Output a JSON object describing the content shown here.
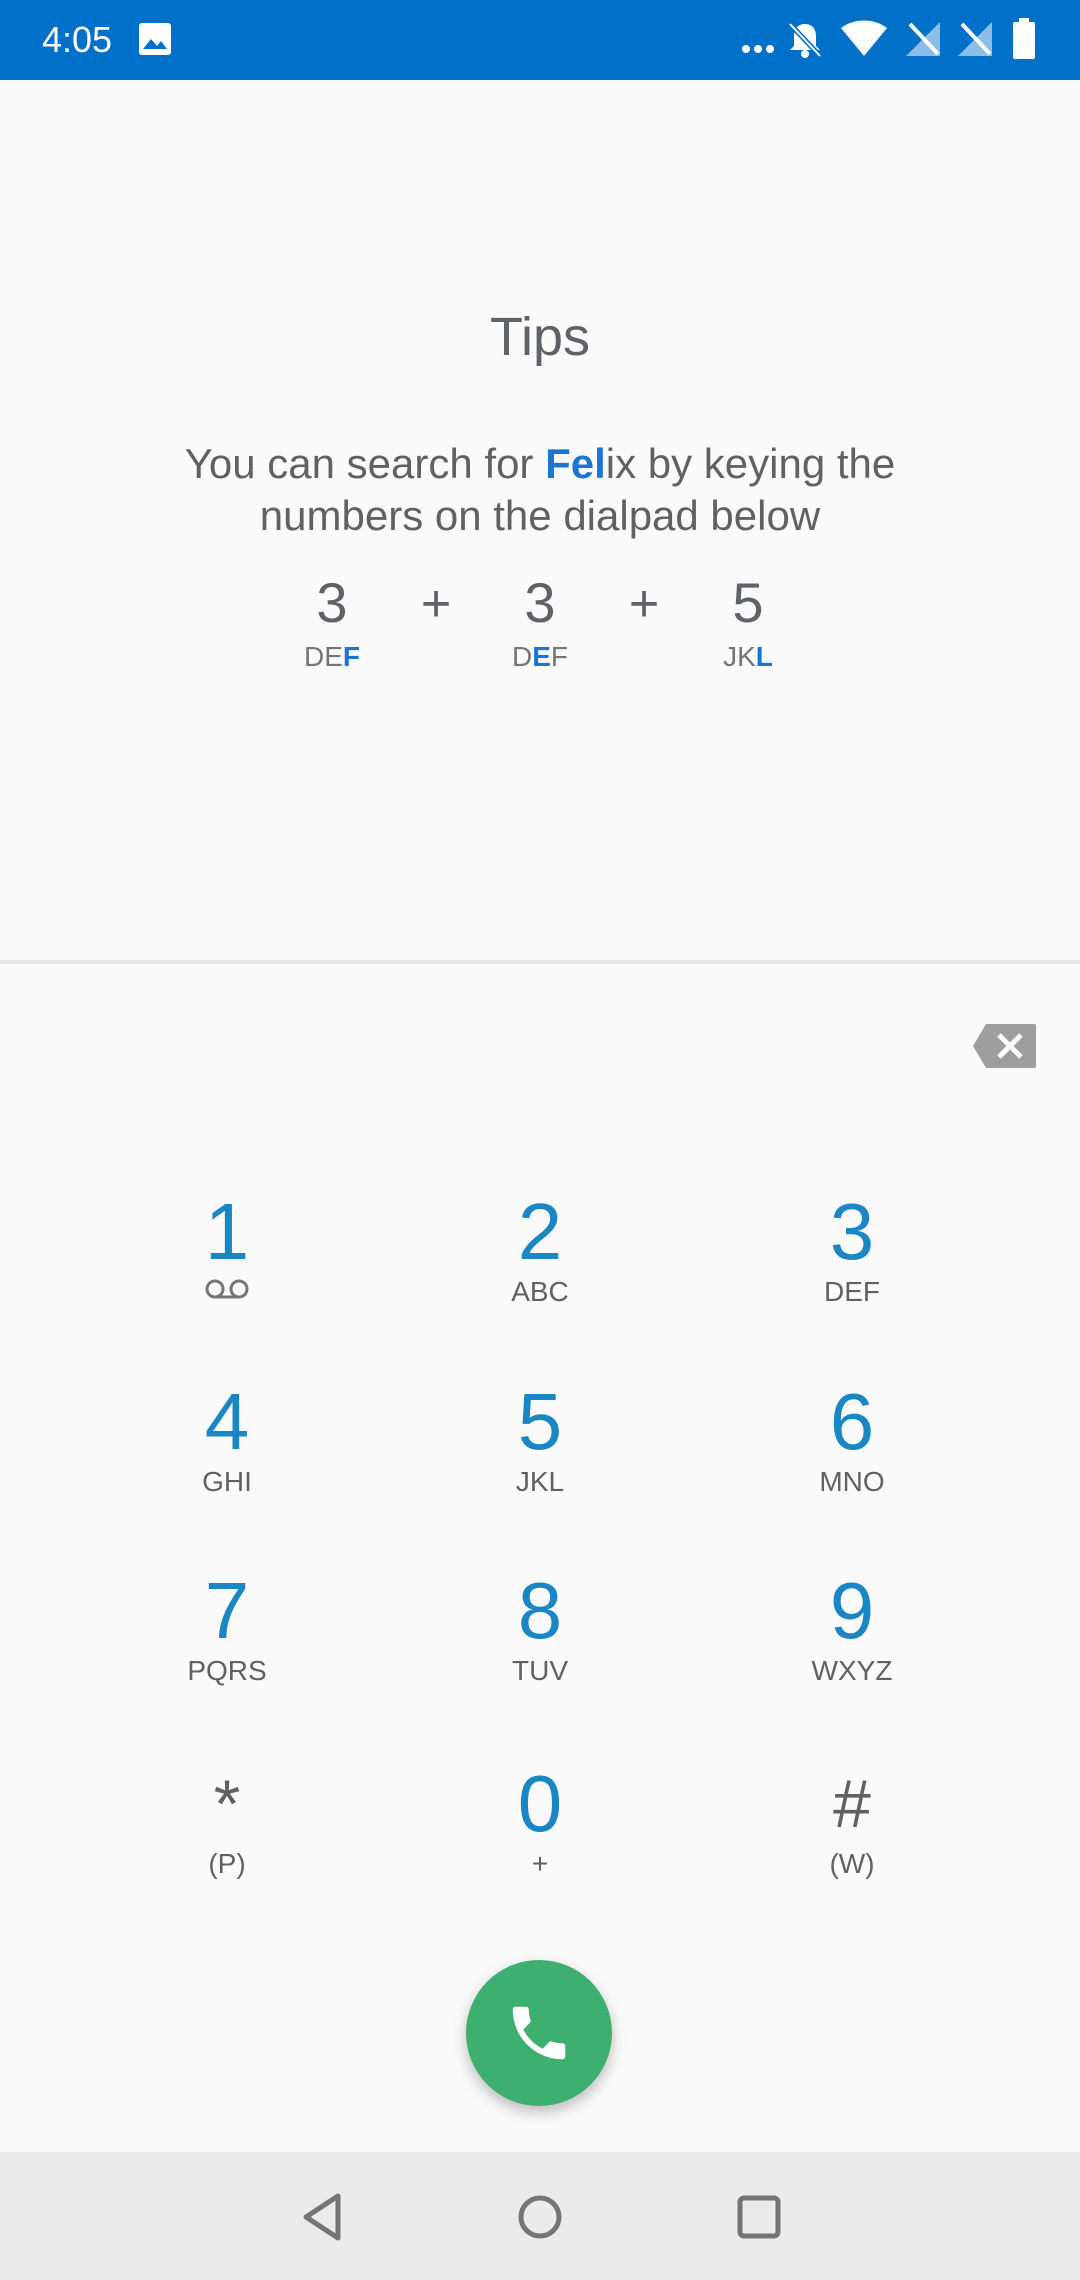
{
  "status_bar": {
    "time": "4:05",
    "icons": [
      "image-icon",
      "more-icon",
      "notifications-off-icon",
      "wifi-icon",
      "no-signal-icon",
      "no-signal-icon",
      "battery-icon"
    ],
    "background": "#0070c9"
  },
  "tips": {
    "title": "Tips",
    "text_pre": "You can search for ",
    "text_hl": "Fel",
    "text_post": "ix by keying the numbers on the dialpad below",
    "combo": [
      {
        "digit": "3",
        "letters_plain": "DE",
        "letters_hl": "F",
        "letters_after": ""
      },
      {
        "digit": "3",
        "letters_plain": "D",
        "letters_hl": "E",
        "letters_after": "F"
      },
      {
        "digit": "5",
        "letters_plain": "JK",
        "letters_hl": "L",
        "letters_after": ""
      }
    ],
    "plus": "+",
    "accent": "#1976d2"
  },
  "dialpad": {
    "keys": [
      {
        "digit": "1",
        "sub": ""
      },
      {
        "digit": "2",
        "sub": "ABC"
      },
      {
        "digit": "3",
        "sub": "DEF"
      },
      {
        "digit": "4",
        "sub": "GHI"
      },
      {
        "digit": "5",
        "sub": "JKL"
      },
      {
        "digit": "6",
        "sub": "MNO"
      },
      {
        "digit": "7",
        "sub": "PQRS"
      },
      {
        "digit": "8",
        "sub": "TUV"
      },
      {
        "digit": "9",
        "sub": "WXYZ"
      },
      {
        "digit": "*",
        "sub": "(P)"
      },
      {
        "digit": "0",
        "sub": "+"
      },
      {
        "digit": "#",
        "sub": "(W)"
      }
    ],
    "digit_color": "#1a86c4",
    "call_color": "#3daf6f"
  },
  "nav": {
    "buttons": [
      "back-icon",
      "home-icon",
      "recents-icon"
    ]
  }
}
